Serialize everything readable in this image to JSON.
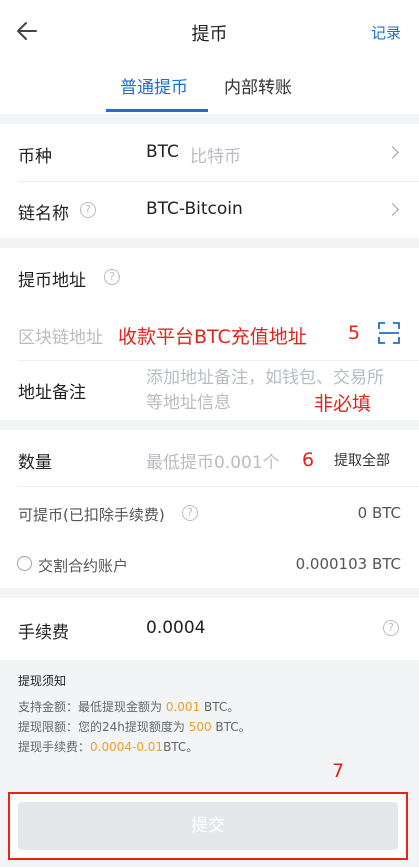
{
  "header": {
    "title": "提币",
    "records_label": "记录"
  },
  "tabs": [
    {
      "label": "普通提币"
    },
    {
      "label": "内部转账"
    }
  ],
  "currency": {
    "label": "币种",
    "code": "BTC",
    "name": "比特币"
  },
  "chain": {
    "label": "链名称",
    "value": "BTC-Bitcoin"
  },
  "address": {
    "label": "提币地址",
    "placeholder": "区块链地址",
    "annotation": "收款平台BTC充值地址",
    "step": "5"
  },
  "memo": {
    "label": "地址备注",
    "placeholder": "添加地址备注，如钱包、交易所等地址信息",
    "annotation": "非必填"
  },
  "amount": {
    "label": "数量",
    "placeholder": "最低提币0.001个",
    "step": "6",
    "withdraw_all": "提取全部"
  },
  "available": {
    "label": "可提币(已扣除手续费)",
    "value": "0 BTC"
  },
  "contract_account": {
    "label": "交割合约账户",
    "value": "0.000103 BTC"
  },
  "fee": {
    "label": "手续费",
    "value": "0.0004"
  },
  "notice": {
    "title": "提现须知",
    "line1_pre": "支持金额：最低提现金额为 ",
    "line1_val": "0.001",
    "line1_post": " BTC。",
    "line2_pre": "提现限额：您的24h提现额度为 ",
    "line2_val": "500",
    "line2_post": " BTC。",
    "line3_pre": "提现手续费：",
    "line3_val": "0.0004-0.01",
    "line3_post": "BTC。"
  },
  "submit": {
    "label": "提交",
    "step": "7"
  },
  "colors": {
    "accent": "#1e6fd0",
    "annotation": "#e3241b",
    "highlight": "#f0a020"
  }
}
